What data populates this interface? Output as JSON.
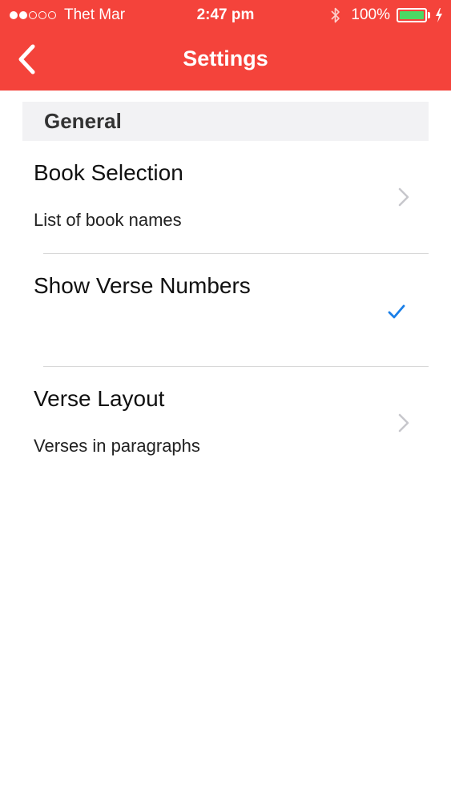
{
  "status_bar": {
    "carrier": "Thet Mar",
    "time": "2:47 pm",
    "battery_percent": "100%",
    "signal_strength": 2,
    "signal_max": 5
  },
  "navbar": {
    "title": "Settings",
    "back_icon": "chevron-left-icon"
  },
  "section": {
    "header": "General"
  },
  "rows": [
    {
      "title": "Book Selection",
      "subtitle": "List of book names",
      "accessory": "chevron-right-icon"
    },
    {
      "title": "Show Verse Numbers",
      "subtitle": "",
      "accessory": "checkmark-icon",
      "checked": true
    },
    {
      "title": "Verse Layout",
      "subtitle": "Verses in paragraphs",
      "accessory": "chevron-right-icon"
    }
  ],
  "colors": {
    "accent": "#f4433b",
    "check": "#1a7fe8",
    "battery": "#4cd964"
  }
}
